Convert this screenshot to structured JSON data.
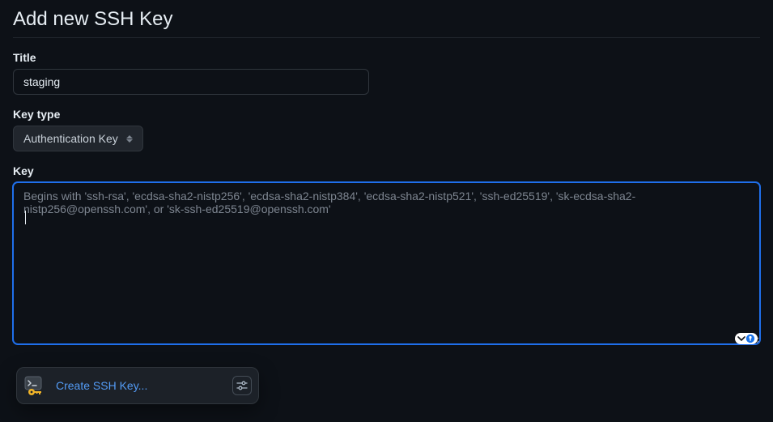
{
  "page": {
    "title": "Add new SSH Key"
  },
  "form": {
    "title": {
      "label": "Title",
      "value": "staging"
    },
    "keyType": {
      "label": "Key type",
      "selected": "Authentication Key"
    },
    "key": {
      "label": "Key",
      "placeholder": "Begins with 'ssh-rsa', 'ecdsa-sha2-nistp256', 'ecdsa-sha2-nistp384', 'ecdsa-sha2-nistp521', 'ssh-ed25519', 'sk-ecdsa-sha2-nistp256@openssh.com', or 'sk-ssh-ed25519@openssh.com'",
      "value": ""
    }
  },
  "autocomplete": {
    "label": "Create SSH Key..."
  }
}
